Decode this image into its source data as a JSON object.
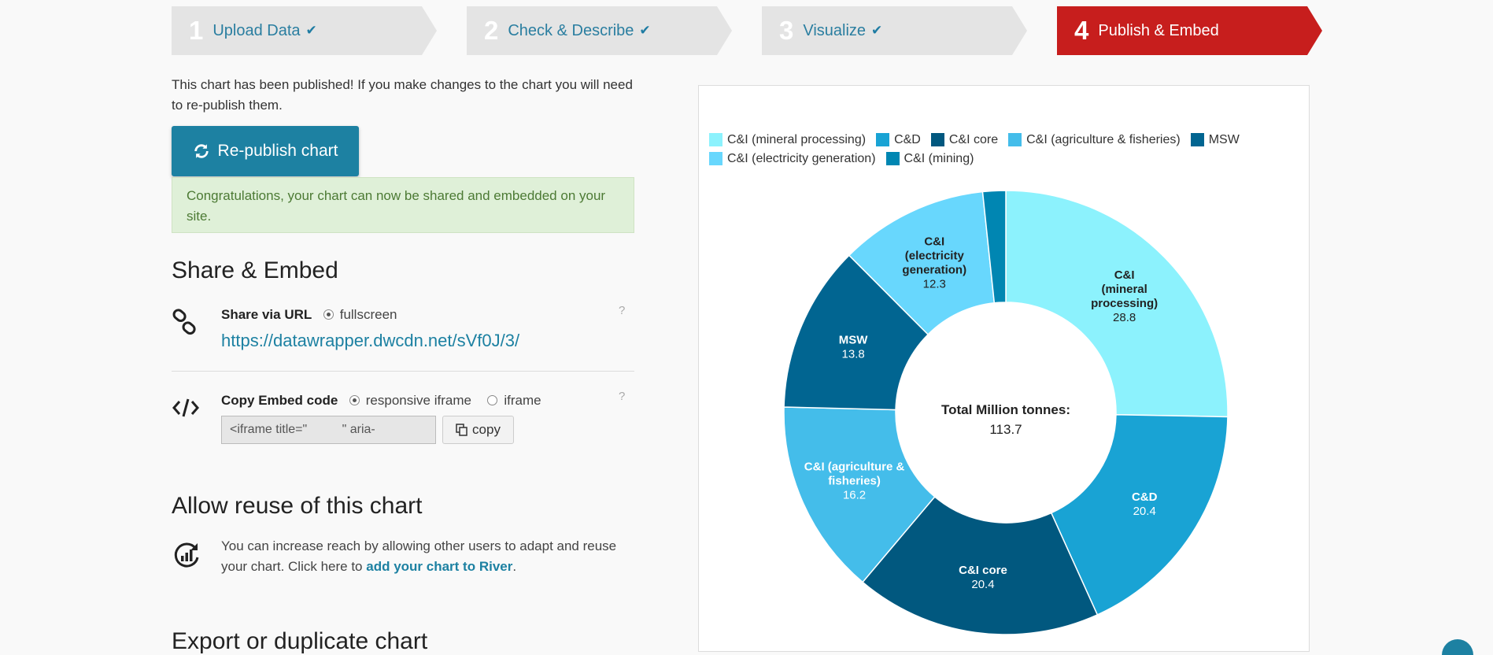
{
  "steps": [
    {
      "num": "1",
      "label": "Upload Data",
      "done": true
    },
    {
      "num": "2",
      "label": "Check & Describe",
      "done": true
    },
    {
      "num": "3",
      "label": "Visualize",
      "done": true
    },
    {
      "num": "4",
      "label": "Publish & Embed",
      "done": false
    }
  ],
  "publish": {
    "note": "This chart has been published! If you make changes to the chart you will need to re-publish them.",
    "republish_label": "Re-publish chart",
    "success": "Congratulations, your chart can now be shared and embedded on your site."
  },
  "share": {
    "title": "Share & Embed",
    "url_label": "Share via URL",
    "url_option": "fullscreen",
    "url": "https://datawrapper.dwcdn.net/sVf0J/3/",
    "embed_label": "Copy Embed code",
    "embed_option_1": "responsive iframe",
    "embed_option_2": "iframe",
    "embed_code": "<iframe title=\"          \" aria-",
    "copy_label": "copy",
    "help": "?"
  },
  "reuse": {
    "title": "Allow reuse of this chart",
    "text": "You can increase reach by allowing other users to adapt and reuse your chart. Click here to ",
    "link": "add your chart to River",
    "text_end": "."
  },
  "export": {
    "title": "Export or duplicate chart"
  },
  "colors": {
    "active_step": "#c71e1d",
    "accent": "#1d81a2",
    "success_bg": "#dff0d8"
  },
  "chart_data": {
    "type": "pie",
    "variant": "donut",
    "legend": "top",
    "center_label": "Total Million tonnes:",
    "center_value": "113.7",
    "series": [
      {
        "name": "C&I (mineral processing)",
        "value": 28.8,
        "color": "#8cf2fd",
        "label_lines": [
          "C&I",
          "(mineral",
          "processing)"
        ],
        "text_color": "#222"
      },
      {
        "name": "C&D",
        "value": 20.4,
        "color": "#19a3d4",
        "label_lines": [
          "C&D"
        ],
        "text_color": "#fff"
      },
      {
        "name": "C&I core",
        "value": 20.4,
        "color": "#01587f",
        "label_lines": [
          "C&I core"
        ],
        "text_color": "#fff"
      },
      {
        "name": "C&I (agriculture & fisheries)",
        "value": 16.2,
        "color": "#44bdea",
        "label_lines": [
          "C&I (agriculture &",
          "fisheries)"
        ],
        "text_color": "#fff"
      },
      {
        "name": "MSW",
        "value": 13.8,
        "color": "#016591",
        "label_lines": [
          "MSW"
        ],
        "text_color": "#fff"
      },
      {
        "name": "C&I (electricity generation)",
        "value": 12.3,
        "color": "#68d7fd",
        "label_lines": [
          "C&I",
          "(electricity",
          "generation)"
        ],
        "text_color": "#222"
      },
      {
        "name": "C&I (mining)",
        "value": 1.9,
        "color": "#0086b2",
        "label_lines": [],
        "text_color": "#fff"
      }
    ],
    "legend_order": [
      0,
      1,
      2,
      3,
      4,
      5,
      6
    ]
  }
}
